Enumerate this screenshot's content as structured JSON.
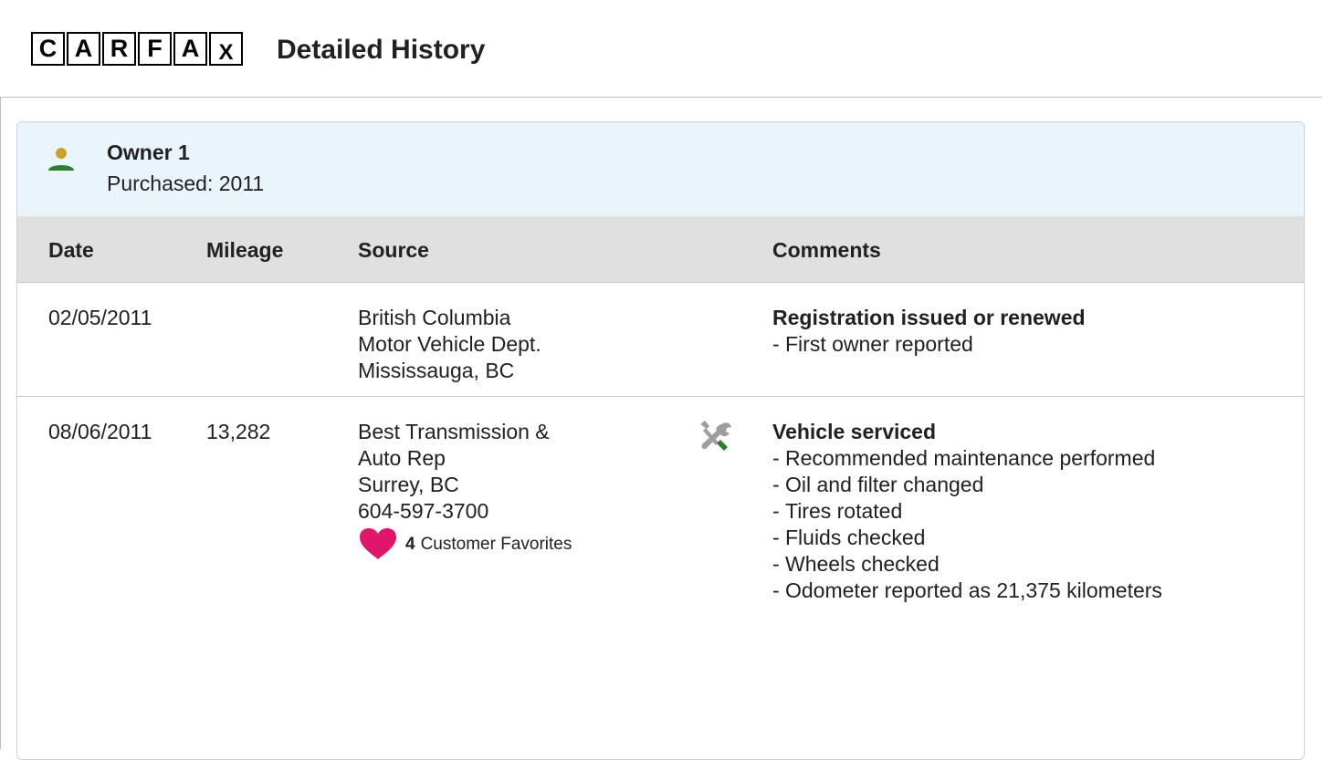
{
  "header": {
    "logo_letters": [
      "C",
      "A",
      "R",
      "F",
      "A",
      "X"
    ],
    "title": "Detailed History"
  },
  "owner": {
    "icon": "person-icon",
    "name": "Owner 1",
    "purchased": "Purchased: 2011"
  },
  "columns": {
    "date": "Date",
    "mileage": "Mileage",
    "source": "Source",
    "comments": "Comments"
  },
  "records": [
    {
      "date": "02/05/2011",
      "mileage": "",
      "source": [
        "British Columbia",
        "Motor Vehicle Dept.",
        "Mississauga, BC"
      ],
      "comment_title": "Registration issued or renewed",
      "comments": [
        "First owner reported"
      ]
    },
    {
      "date": "08/06/2011",
      "mileage": "13,282",
      "source": [
        "Best Transmission &",
        "Auto Rep",
        "Surrey, BC",
        "604-597-3700"
      ],
      "favorites_count": "4",
      "favorites_label": "Customer Favorites",
      "icon": "wrench-screwdriver-icon",
      "comment_title": "Vehicle serviced",
      "comments": [
        "Recommended maintenance performed",
        "Oil and filter changed",
        "Tires rotated",
        "Fluids checked",
        "Wheels checked",
        "Odometer reported as 21,375 kilometers"
      ]
    }
  ],
  "colors": {
    "owner_band": "#eaf4fb",
    "header_row": "#e0e0e0",
    "person_head": "#c9a227",
    "person_body": "#2e7d32",
    "heart": "#e0166a",
    "tool_grey": "#9e9e9e",
    "tool_green": "#2e7d32"
  }
}
